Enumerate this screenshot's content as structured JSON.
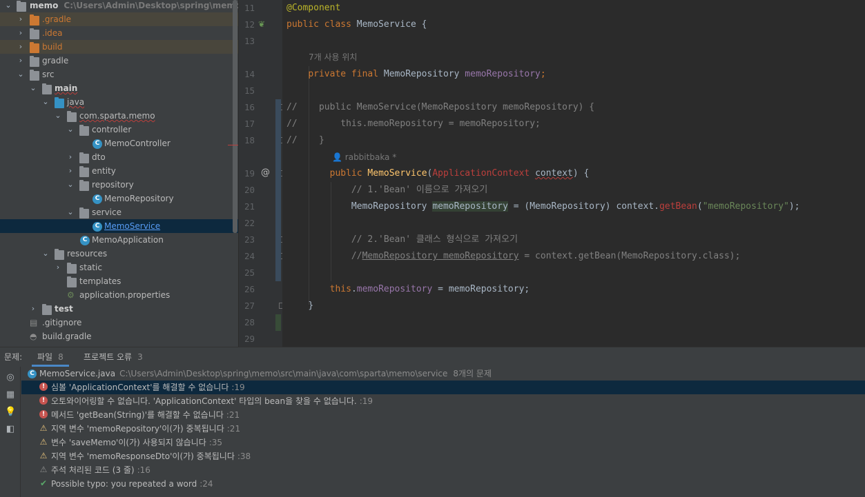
{
  "tree": {
    "items": [
      {
        "label": "memo",
        "path": "C:\\Users\\Admin\\Desktop\\spring\\memo"
      },
      {
        "label": ".gradle"
      },
      {
        "label": ".idea"
      },
      {
        "label": "build"
      },
      {
        "label": "gradle"
      },
      {
        "label": "src"
      },
      {
        "label": "main"
      },
      {
        "label": "java"
      },
      {
        "label": "com.sparta.memo"
      },
      {
        "label": "controller"
      },
      {
        "label": "MemoController"
      },
      {
        "label": "dto"
      },
      {
        "label": "entity"
      },
      {
        "label": "repository"
      },
      {
        "label": "MemoRepository"
      },
      {
        "label": "service"
      },
      {
        "label": "MemoService"
      },
      {
        "label": "MemoApplication"
      },
      {
        "label": "resources"
      },
      {
        "label": "static"
      },
      {
        "label": "templates"
      },
      {
        "label": "application.properties"
      },
      {
        "label": "test"
      },
      {
        "label": ".gitignore"
      },
      {
        "label": "build.gradle"
      }
    ]
  },
  "editor": {
    "line_numbers": [
      "11",
      "12",
      "13",
      "14",
      "15",
      "16",
      "17",
      "18",
      "19",
      "20",
      "21",
      "22",
      "23",
      "24",
      "25",
      "26",
      "27",
      "28",
      "29"
    ],
    "usages_hint": "7개 사용 위치",
    "author_hint": "rabbitbaka *",
    "code": {
      "l11": "@Component",
      "l12_kw": "public class ",
      "l12_name": "MemoService {",
      "l14_kw": "private final ",
      "l14_type": "MemoRepository ",
      "l14_field": "memoRepository",
      "l14_end": ";",
      "l16": "//    public MemoService(MemoRepository memoRepository) {",
      "l17": "//        this.memoRepository = memoRepository;",
      "l18": "//    }",
      "l19_kw": "public ",
      "l19_name": "MemoService",
      "l19_paren": "(",
      "l19_type": "ApplicationContext",
      "l19_sp": " ",
      "l19_param": "context",
      "l19_end": ") {",
      "l20": "// 1.'Bean' 이름으로 가져오기",
      "l21_type": "MemoRepository ",
      "l21_var": "memoRepository",
      "l21_mid": " = (MemoRepository) context.",
      "l21_call": "getBean",
      "l21_open": "(",
      "l21_str": "\"memoRepository\"",
      "l21_end": ");",
      "l23": "// 2.'Bean' 클래스 형식으로 가져오기",
      "l24_a": "//",
      "l24_b": "MemoRepository memoRepository",
      "l24_c": " = context.getBean(MemoRepository.class);",
      "l26_kw": "this",
      "l26_dot": ".",
      "l26_field": "memoRepository",
      "l26_end": " = memoRepository;",
      "l27": "}"
    }
  },
  "problems": {
    "label": "문제:",
    "tabs": [
      {
        "label": "파일",
        "count": "8"
      },
      {
        "label": "프로젝트 오류",
        "count": "3"
      }
    ],
    "file": {
      "name": "MemoService.java",
      "path": "C:\\Users\\Admin\\Desktop\\spring\\memo\\src\\main\\java\\com\\sparta\\memo\\service",
      "count": "8개의 문제"
    },
    "items": [
      {
        "severity": "error",
        "text": "심볼 'ApplicationContext'를 해결할 수 없습니다",
        "line": ":19"
      },
      {
        "severity": "error",
        "text": "오토와이어링할 수 없습니다. 'ApplicationContext' 타입의 bean을 찾을 수 없습니다.",
        "line": ":19"
      },
      {
        "severity": "error",
        "text": "메서드 'getBean(String)'를 해결할 수 없습니다",
        "line": ":21"
      },
      {
        "severity": "warning",
        "text": "지역 변수 'memoRepository'이(가) 중복됩니다",
        "line": ":21"
      },
      {
        "severity": "warning",
        "text": "변수 'saveMemo'이(가) 사용되지 않습니다",
        "line": ":35"
      },
      {
        "severity": "warning",
        "text": "지역 변수 'memoResponseDto'이(가) 중복됩니다",
        "line": ":38"
      },
      {
        "severity": "weak",
        "text": "주석 처리된 코드 (3 줄)",
        "line": ":16"
      },
      {
        "severity": "typo",
        "text": "Possible typo: you repeated a word",
        "line": ":24"
      }
    ]
  },
  "colors": {
    "keyword": "#cc7832",
    "annotation": "#bbb529",
    "string": "#6a8759",
    "field": "#9876aa",
    "method": "#ffc66d",
    "error": "#bc3f3c",
    "selection": "#0d293e"
  },
  "icons": [
    "folder-icon",
    "class-icon",
    "spring-bean-icon",
    "chevron-right-icon",
    "chevron-down-icon",
    "error-icon",
    "warning-icon",
    "check-icon"
  ]
}
